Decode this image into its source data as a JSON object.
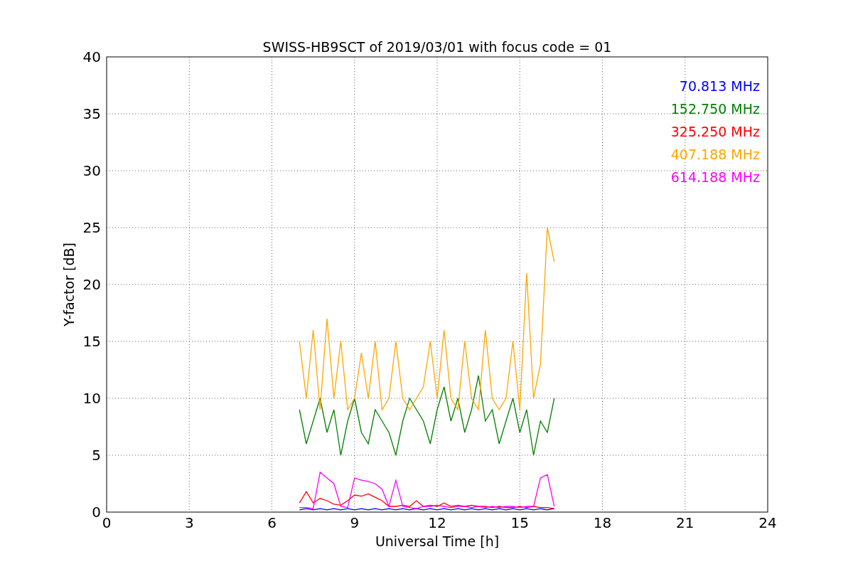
{
  "figure": {
    "chart_data": {
      "type": "line",
      "title": "SWISS-HB9SCT of 2019/03/01 with focus code = 01",
      "xlabel": "Universal Time [h]",
      "ylabel": "Y-factor [dB]",
      "x": [
        7,
        7.25,
        7.5,
        7.75,
        8,
        8.25,
        8.5,
        8.75,
        9,
        9.25,
        9.5,
        9.75,
        10,
        10.25,
        10.5,
        10.75,
        11,
        11.25,
        11.5,
        11.75,
        12,
        12.25,
        12.5,
        12.75,
        13,
        13.25,
        13.5,
        13.75,
        14,
        14.25,
        14.5,
        14.75,
        15,
        15.25,
        15.5,
        15.75,
        16,
        16.25
      ],
      "series": [
        {
          "name": "70.813 MHz",
          "color": "#0000ff",
          "values": [
            0.2,
            0.3,
            0.2,
            0.3,
            0.2,
            0.3,
            0.2,
            0.3,
            0.2,
            0.3,
            0.2,
            0.3,
            0.2,
            0.3,
            0.2,
            0.3,
            0.2,
            0.3,
            0.2,
            0.3,
            0.2,
            0.3,
            0.2,
            0.3,
            0.2,
            0.3,
            0.2,
            0.3,
            0.2,
            0.3,
            0.2,
            0.3,
            0.2,
            0.3,
            0.2,
            0.3,
            0.2,
            0.3
          ]
        },
        {
          "name": "152.750 MHz",
          "color": "#008000",
          "values": [
            9,
            6,
            8,
            10,
            7,
            9,
            5,
            8,
            10,
            7,
            6,
            9,
            8,
            7,
            5,
            8,
            10,
            9,
            8,
            6,
            9,
            11,
            8,
            10,
            7,
            9,
            12,
            8,
            9,
            6,
            8,
            10,
            7,
            9,
            5,
            8,
            7,
            10
          ]
        },
        {
          "name": "325.250 MHz",
          "color": "#ff0000",
          "values": [
            0.8,
            1.8,
            0.8,
            1.2,
            1.0,
            0.7,
            0.6,
            1.0,
            1.5,
            1.4,
            1.6,
            1.3,
            1.0,
            0.5,
            0.5,
            0.6,
            0.5,
            1.0,
            0.5,
            0.6,
            0.5,
            0.8,
            0.5,
            0.6,
            0.5,
            0.6,
            0.5,
            0.5,
            0.4,
            0.5,
            0.4,
            0.4,
            0.5,
            0.4,
            0.5,
            0.4,
            0.4,
            0.3
          ]
        },
        {
          "name": "407.188 MHz",
          "color": "#ffa500",
          "values": [
            15,
            10,
            16,
            9,
            17,
            10,
            15,
            9,
            10,
            14,
            10,
            15,
            9,
            10,
            15,
            10,
            9,
            10,
            11,
            15,
            10,
            16,
            10,
            9,
            15,
            10,
            9,
            16,
            10,
            9,
            10,
            15,
            9,
            21,
            10,
            13,
            25,
            22
          ]
        },
        {
          "name": "614.188 MHz",
          "color": "#ff00ff",
          "values": [
            0.4,
            0.4,
            0.3,
            3.5,
            3.0,
            2.5,
            0.5,
            0.4,
            3.0,
            2.8,
            2.7,
            2.5,
            2.0,
            0.5,
            2.8,
            0.5,
            0.4,
            0.3,
            0.5,
            0.5,
            0.6,
            0.5,
            0.4,
            0.5,
            0.5,
            0.4,
            0.5,
            0.4,
            0.5,
            0.4,
            0.5,
            0.5,
            0.4,
            0.5,
            0.5,
            3.0,
            3.3,
            0.5
          ]
        }
      ],
      "xlim": [
        0,
        24
      ],
      "ylim": [
        0,
        40
      ],
      "xticks": [
        0,
        3,
        6,
        9,
        12,
        15,
        18,
        21,
        24
      ],
      "yticks": [
        0,
        5,
        10,
        15,
        20,
        25,
        30,
        35,
        40
      ],
      "grid": true
    }
  }
}
